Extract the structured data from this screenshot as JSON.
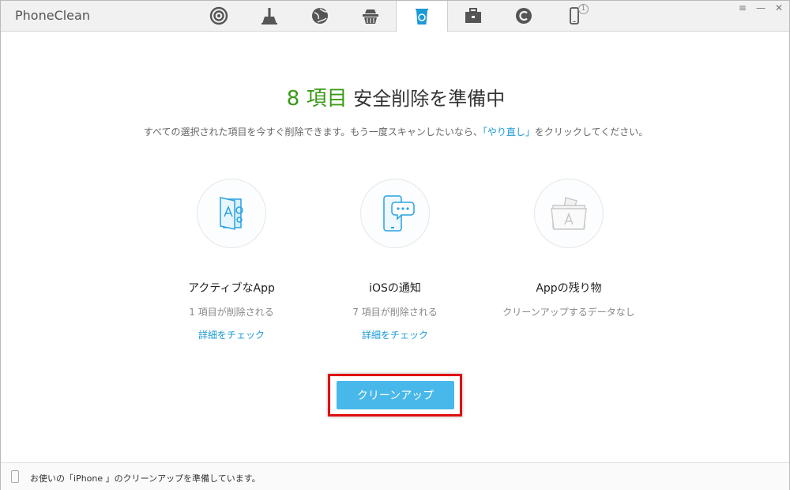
{
  "app": {
    "title": "PhoneClean"
  },
  "tabs": [
    {
      "icon": "signal-icon",
      "active": false
    },
    {
      "icon": "broom-icon",
      "active": false
    },
    {
      "icon": "globe-icon",
      "active": false
    },
    {
      "icon": "basket-icon",
      "active": false
    },
    {
      "icon": "recycle-icon",
      "active": true
    },
    {
      "icon": "toolbox-icon",
      "active": false
    },
    {
      "icon": "restore-icon",
      "active": false
    },
    {
      "icon": "phone-icon",
      "active": false,
      "badge": "1"
    }
  ],
  "window_controls": {
    "menu": "≡",
    "minimize": "—",
    "close": "✕"
  },
  "headline": {
    "count": "8 項目",
    "text": " 安全削除を準備中"
  },
  "subtext": {
    "before": "すべての選択された項目を今すぐ削除できます。もう一度スキャンしたいなら、",
    "link": "「やり直し」",
    "after": "をクリックしてください。"
  },
  "categories": [
    {
      "icon": "app-gear-icon",
      "name": "アクティブなApp",
      "desc": "1 項目が削除される",
      "check": "詳細をチェック"
    },
    {
      "icon": "phone-chat-icon",
      "name": "iOSの通知",
      "desc": "7 項目が削除される",
      "check": "詳細をチェック"
    },
    {
      "icon": "app-folder-icon",
      "name": "Appの残り物",
      "desc": "クリーンアップするデータなし",
      "check": ""
    }
  ],
  "cleanup_button": "クリーンアップ",
  "status": {
    "text": "お使いの「iPhone 」のクリーンアップを準備しています。"
  },
  "colors": {
    "accent": "#1b9ad6",
    "count": "#3a9a17",
    "button": "#48b8ea",
    "highlight": "#e01010"
  }
}
